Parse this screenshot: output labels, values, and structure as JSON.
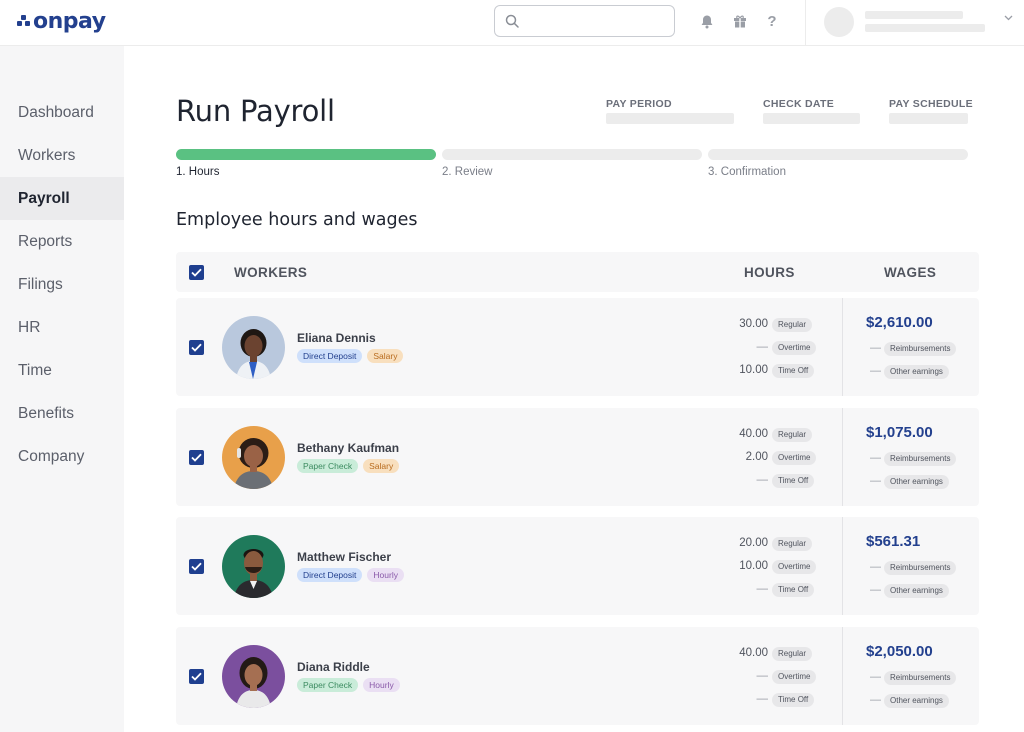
{
  "brand": {
    "name": "onpay",
    "color": "#23408e"
  },
  "topbar": {
    "search": {
      "placeholder": ""
    },
    "icons": [
      "bell-icon",
      "gift-icon",
      "help-icon"
    ],
    "help_glyph": "?"
  },
  "sidebar": {
    "items": [
      {
        "label": "Dashboard",
        "active": false
      },
      {
        "label": "Workers",
        "active": false
      },
      {
        "label": "Payroll",
        "active": true
      },
      {
        "label": "Reports",
        "active": false
      },
      {
        "label": "Filings",
        "active": false
      },
      {
        "label": "HR",
        "active": false
      },
      {
        "label": "Time",
        "active": false
      },
      {
        "label": "Benefits",
        "active": false
      },
      {
        "label": "Company",
        "active": false
      }
    ]
  },
  "page": {
    "title": "Run Payroll",
    "meta": {
      "pay_period": "PAY PERIOD",
      "check_date": "CHECK DATE",
      "pay_schedule": "PAY SCHEDULE"
    },
    "steps": [
      {
        "label": "1. Hours",
        "complete": true
      },
      {
        "label": "2. Review",
        "complete": false
      },
      {
        "label": "3. Confirmation",
        "complete": false
      }
    ],
    "section_title": "Employee hours and wages",
    "table": {
      "headers": {
        "workers": "WORKERS",
        "hours": "HOURS",
        "wages": "WAGES"
      },
      "hour_types": [
        "Regular",
        "Overtime",
        "Time Off"
      ],
      "wage_types": [
        "Reimbursements",
        "Other earnings"
      ],
      "dash": "—",
      "rows": [
        {
          "name": "Eliana Dennis",
          "payment": "Direct Deposit",
          "pay_type": "Salary",
          "hours": [
            "30.00",
            "—",
            "10.00"
          ],
          "wage": "$2,610.00"
        },
        {
          "name": "Bethany Kaufman",
          "payment": "Paper Check",
          "pay_type": "Salary",
          "hours": [
            "40.00",
            "2.00",
            "—"
          ],
          "wage": "$1,075.00"
        },
        {
          "name": "Matthew Fischer",
          "payment": "Direct Deposit",
          "pay_type": "Hourly",
          "hours": [
            "20.00",
            "10.00",
            "—"
          ],
          "wage": "$561.31"
        },
        {
          "name": "Diana Riddle",
          "payment": "Paper Check",
          "pay_type": "Hourly",
          "hours": [
            "40.00",
            "—",
            "—"
          ],
          "wage": "$2,050.00"
        }
      ]
    }
  },
  "colors": {
    "progress_done": "#5ac182",
    "checkbox": "#1f3f8f",
    "wage_text": "#23408e"
  }
}
